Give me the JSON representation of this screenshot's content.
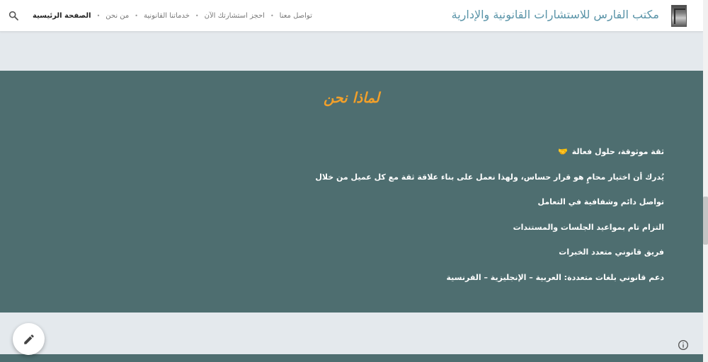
{
  "header": {
    "site_title": "مكتب الفارس للاستشارات القانونية والإدارية",
    "nav": [
      {
        "label": "الصفحة الرئيسية",
        "active": true
      },
      {
        "label": "من نحن",
        "active": false
      },
      {
        "label": "خدماتنا القانونية",
        "active": false
      },
      {
        "label": "احجز استشارتك الآن",
        "active": false
      },
      {
        "label": "تواصل معنا",
        "active": false
      }
    ],
    "nav_separator": "•",
    "search_icon": "search-icon"
  },
  "why_us": {
    "title": "لماذا نحن",
    "items": [
      "ثقة موثوقة، حلول فعالة",
      "يُدرك أن اختيار محامٍ هو قرار حساس، ولهذا نعمل على بناء علاقة ثقة مع كل عميل من خلال",
      "تواصل دائم وشفافية في التعامل",
      "التزام تام بمواعيد الجلسات والمستندات",
      "فريق قانوني متعدد الخبرات",
      "دعم قانوني بلغات متعددة: العربية – الإنجليزية – الفرنسية"
    ],
    "first_item_icon": "handshake-icon"
  },
  "colors": {
    "section_bg": "#4e6e70",
    "title_accent": "#f2a02a",
    "site_title": "#5a94a8",
    "page_bg": "#e4e9ed"
  },
  "icons": {
    "edit": "pencil-icon",
    "info": "info-icon"
  }
}
